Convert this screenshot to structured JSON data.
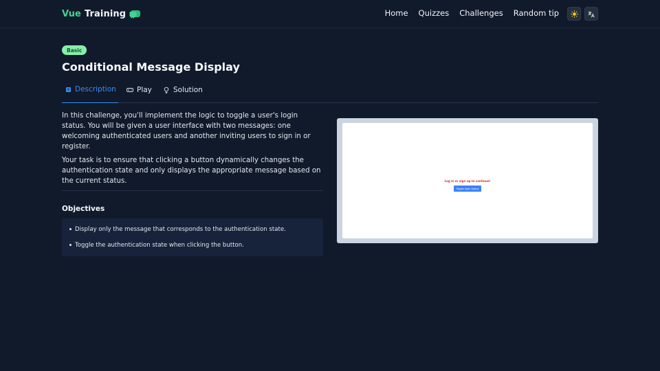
{
  "brand": {
    "part1": "Vue",
    "part2": "Training",
    "icon": "chat-bubble-icon"
  },
  "nav": {
    "items": [
      {
        "label": "Home"
      },
      {
        "label": "Quizzes"
      },
      {
        "label": "Challenges"
      },
      {
        "label": "Random tip"
      }
    ],
    "theme_icon": "sun-icon",
    "language_icon": "translate-icon"
  },
  "challenge": {
    "difficulty": "Basic",
    "title": "Conditional Message Display"
  },
  "tabs": [
    {
      "label": "Description",
      "icon": "book-icon",
      "active": true
    },
    {
      "label": "Play",
      "icon": "gamepad-icon",
      "active": false
    },
    {
      "label": "Solution",
      "icon": "lightbulb-icon",
      "active": false
    }
  ],
  "description": {
    "paragraphs": [
      "In this challenge, you'll implement the logic to toggle a user's login status. You will be given a user interface with two messages: one welcoming authenticated users and another inviting users to sign in or register.",
      "Your task is to ensure that clicking a button dynamically changes the authentication state and only displays the appropriate message based on the current status."
    ]
  },
  "objectives": {
    "title": "Objectives",
    "items": [
      "Display only the message that corresponds to the authentication state.",
      "Toggle the authentication state when clicking the button."
    ]
  },
  "preview": {
    "message": "Log in or sign up to continue!",
    "button_label": "Toggle login status"
  },
  "colors": {
    "background": "#111a2b",
    "accent": "#3b8cf0",
    "brand_green": "#42d392",
    "badge_bg": "#86efac",
    "preview_message": "#dc2626",
    "preview_button": "#3b82f6"
  }
}
